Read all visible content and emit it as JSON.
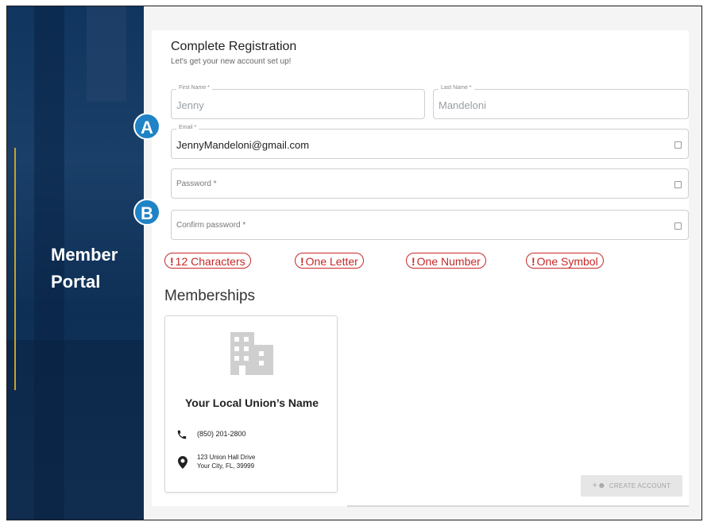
{
  "brand": {
    "line1": "Member",
    "line2": "Portal"
  },
  "registration": {
    "title": "Complete Registration",
    "subtitle": "Let's get your new account set up!",
    "first_name": {
      "label": "First Name *",
      "value": "Jenny"
    },
    "last_name": {
      "label": "Last Name *",
      "value": "Mandeloni"
    },
    "email": {
      "label": "Email *",
      "value": "JennyMandeloni@gmail.com"
    },
    "password": {
      "placeholder": "Password *"
    },
    "confirm_password": {
      "placeholder": "Confirm password *"
    }
  },
  "requirements": [
    {
      "bang": "!",
      "label": "12 Characters"
    },
    {
      "bang": "!",
      "label": "One Letter"
    },
    {
      "bang": "!",
      "label": "One Number"
    },
    {
      "bang": "!",
      "label": "One Symbol"
    }
  ],
  "memberships": {
    "title": "Memberships",
    "card": {
      "name": "Your Local Union’s Name",
      "phone": "(850) 201-2800",
      "address_line1": "123 Union Hall Drive",
      "address_line2": "Your City, FL, 39999"
    }
  },
  "create_button": {
    "label": "CREATE ACCOUNT"
  },
  "annotations": {
    "a": "A",
    "b": "B"
  },
  "colors": {
    "accent": "#1f83c5",
    "error": "#c62828",
    "panel": "#10355f",
    "gold": "#c9a227"
  },
  "icons": [
    "building-icon",
    "phone-icon",
    "location-pin-icon",
    "add-person-icon",
    "field-trailing-icon"
  ]
}
